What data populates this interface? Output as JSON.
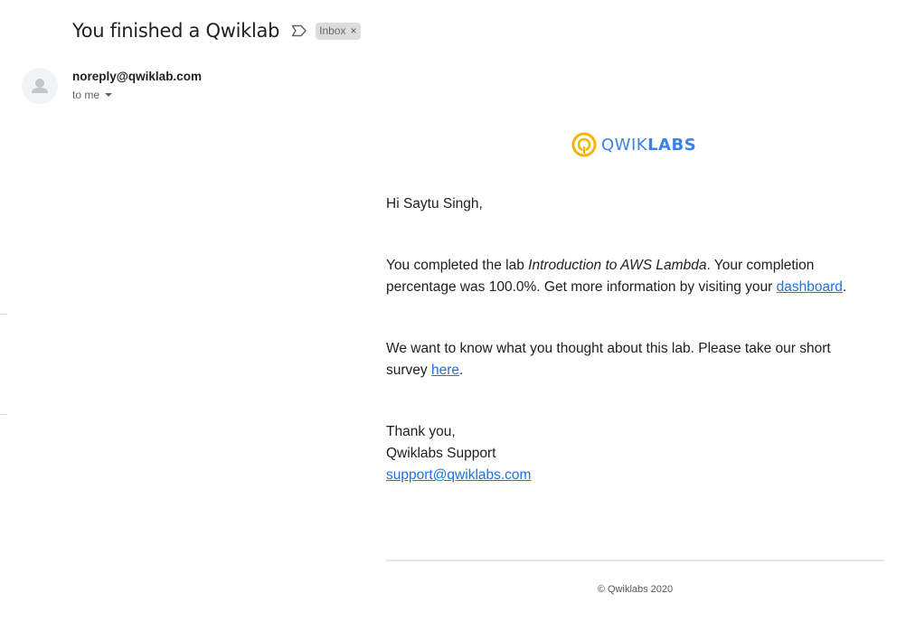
{
  "subject": "You finished a Qwiklab",
  "label_chip": {
    "text": "Inbox",
    "remove_glyph": "×"
  },
  "sender": {
    "email": "noreply@qwiklab.com",
    "to_text": "to me"
  },
  "logo": {
    "text_regular": "QWIK",
    "text_bold": "LABS",
    "icon": "qwiklabs-logo-icon",
    "colors": {
      "ring": "#f4b400",
      "text": "#3b82e8"
    }
  },
  "body": {
    "greeting": "Hi Saytu Singh,",
    "completion": {
      "prefix": "You completed the lab ",
      "lab_name": "Introduction to AWS Lambda",
      "middle": ". Your completion percentage was 100.0%. Get more information by visiting your ",
      "link": "dashboard",
      "suffix": "."
    },
    "survey": {
      "prefix": "We want to know what you thought about this lab. Please take our short survey ",
      "link": "here",
      "suffix": "."
    },
    "signoff": "Thank you,",
    "signature": "Qwiklabs Support",
    "support_email": "support@qwiklabs.com"
  },
  "footer": "© Qwiklabs 2020",
  "colors": {
    "link": "#1a73e8",
    "text": "#202124",
    "muted": "#5f6368"
  }
}
